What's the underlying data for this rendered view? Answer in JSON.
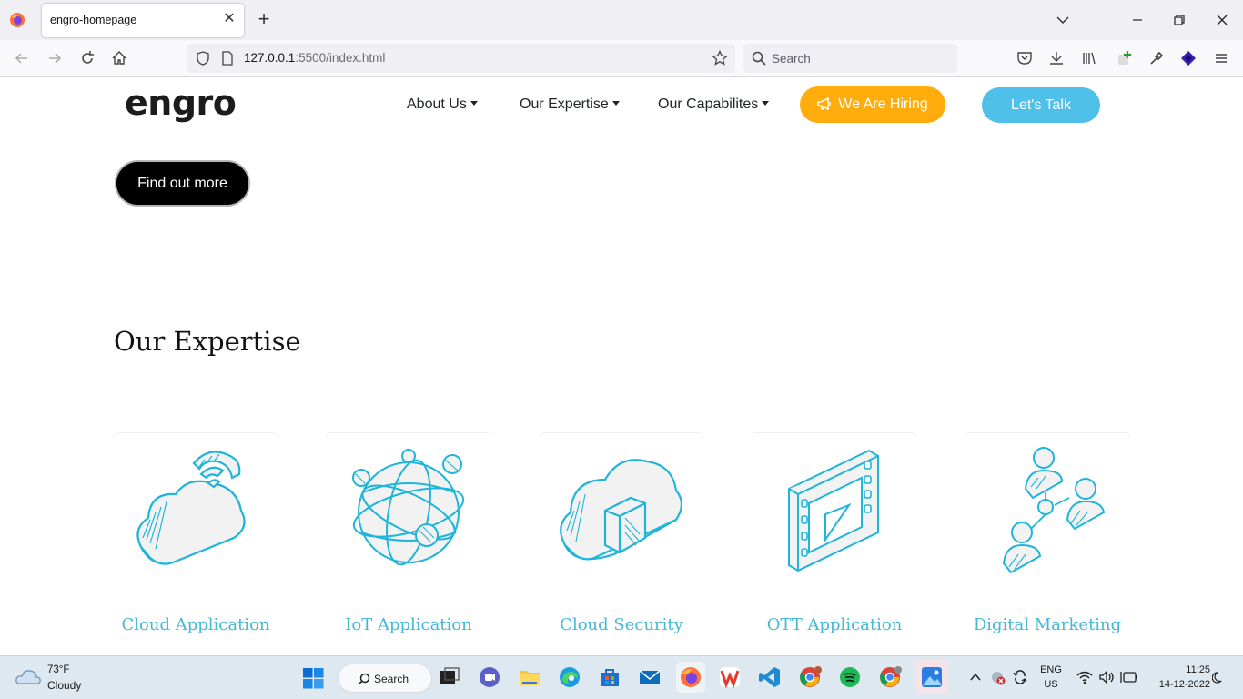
{
  "browser": {
    "tab_title": "engro-homepage",
    "url_host": "127.0.0.1",
    "url_path": ":5500/index.html",
    "search_placeholder": "Search"
  },
  "page": {
    "logo": "engro",
    "nav": {
      "about": "About Us",
      "expertise": "Our Expertise",
      "capabilities": "Our Capabilites",
      "hiring": "We Are Hiring",
      "talk": "Let's Talk"
    },
    "find_out_more": "Find out more",
    "section_title": "Our Expertise",
    "cards": [
      {
        "title": "Cloud Application",
        "icon": "cloud-wifi-icon"
      },
      {
        "title": "IoT Application",
        "icon": "globe-network-icon"
      },
      {
        "title": "Cloud Security",
        "icon": "cloud-shield-icon"
      },
      {
        "title": "OTT Application",
        "icon": "film-play-icon"
      },
      {
        "title": "Digital Marketing",
        "icon": "people-network-icon"
      }
    ],
    "colors": {
      "accent_blue": "#46b8d4",
      "hiring_orange": "#ffac0c",
      "talk_blue": "#4fc0ea"
    }
  },
  "taskbar": {
    "weather_temp": "73°F",
    "weather_condition": "Cloudy",
    "search_label": "Search",
    "lang_top": "ENG",
    "lang_bottom": "US",
    "time": "11:25",
    "date": "14-12-2022"
  }
}
